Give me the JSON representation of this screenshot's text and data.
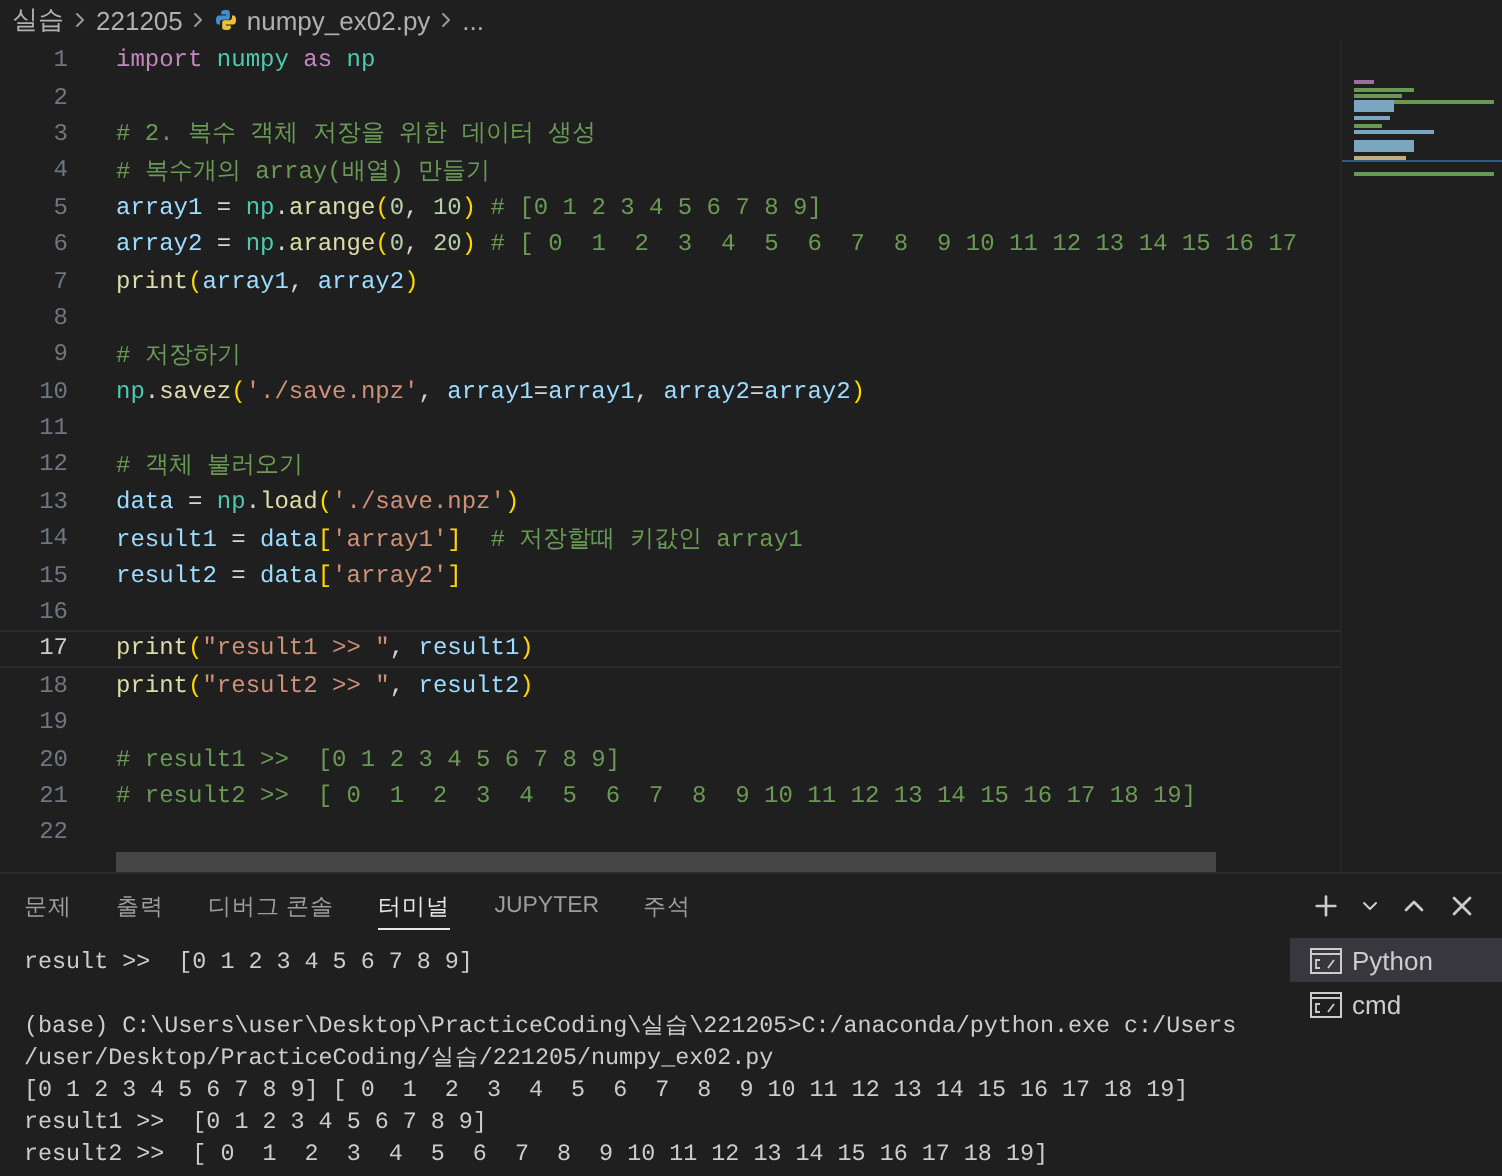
{
  "breadcrumb": [
    {
      "label": "실습",
      "kind": "folder"
    },
    {
      "label": "221205",
      "kind": "folder"
    },
    {
      "label": "numpy_ex02.py",
      "kind": "file"
    },
    {
      "label": "...",
      "kind": "more"
    }
  ],
  "editor": {
    "lines": [
      {
        "number": "1",
        "current": false,
        "tokens": [
          {
            "kind": "keyword",
            "text": "import "
          },
          {
            "kind": "module",
            "text": "numpy "
          },
          {
            "kind": "keyword",
            "text": "as "
          },
          {
            "kind": "module",
            "text": "np"
          }
        ]
      },
      {
        "number": "2",
        "current": false
      },
      {
        "number": "3",
        "current": false,
        "tokens": [
          {
            "kind": "comment",
            "text": "# 2. 복수 객체 저장을 위한 데이터 생성"
          }
        ]
      },
      {
        "number": "4",
        "current": false,
        "tokens": [
          {
            "kind": "comment",
            "text": "# 복수개의 array(배열) 만들기"
          }
        ]
      },
      {
        "number": "5",
        "current": false,
        "tokens": [
          {
            "kind": "variable",
            "text": "array1"
          },
          {
            "kind": "plain",
            "text": " = "
          },
          {
            "kind": "module",
            "text": "np"
          },
          {
            "kind": "plain",
            "text": "."
          },
          {
            "kind": "function",
            "text": "arange"
          },
          {
            "kind": "paren",
            "text": "("
          },
          {
            "kind": "number",
            "text": "0"
          },
          {
            "kind": "plain",
            "text": ", "
          },
          {
            "kind": "number",
            "text": "10"
          },
          {
            "kind": "paren",
            "text": ")"
          },
          {
            "kind": "comment",
            "text": " # [0 1 2 3 4 5 6 7 8 9]"
          }
        ]
      },
      {
        "number": "6",
        "current": false,
        "tokens": [
          {
            "kind": "variable",
            "text": "array2"
          },
          {
            "kind": "plain",
            "text": " = "
          },
          {
            "kind": "module",
            "text": "np"
          },
          {
            "kind": "plain",
            "text": "."
          },
          {
            "kind": "function",
            "text": "arange"
          },
          {
            "kind": "paren",
            "text": "("
          },
          {
            "kind": "number",
            "text": "0"
          },
          {
            "kind": "plain",
            "text": ", "
          },
          {
            "kind": "number",
            "text": "20"
          },
          {
            "kind": "paren",
            "text": ")"
          },
          {
            "kind": "comment",
            "text": " # [ 0  1  2  3  4  5  6  7  8  9 10 11 12 13 14 15 16 17"
          }
        ]
      },
      {
        "number": "7",
        "current": false,
        "tokens": [
          {
            "kind": "function",
            "text": "print"
          },
          {
            "kind": "paren",
            "text": "("
          },
          {
            "kind": "variable",
            "text": "array1"
          },
          {
            "kind": "plain",
            "text": ", "
          },
          {
            "kind": "variable",
            "text": "array2"
          },
          {
            "kind": "paren",
            "text": ")"
          }
        ]
      },
      {
        "number": "8",
        "current": false
      },
      {
        "number": "9",
        "current": false,
        "tokens": [
          {
            "kind": "comment",
            "text": "# 저장하기"
          }
        ]
      },
      {
        "number": "10",
        "current": false,
        "tokens": [
          {
            "kind": "module",
            "text": "np"
          },
          {
            "kind": "plain",
            "text": "."
          },
          {
            "kind": "function",
            "text": "savez"
          },
          {
            "kind": "paren",
            "text": "("
          },
          {
            "kind": "string",
            "text": "'./save.npz'"
          },
          {
            "kind": "plain",
            "text": ", "
          },
          {
            "kind": "variable",
            "text": "array1"
          },
          {
            "kind": "plain",
            "text": "="
          },
          {
            "kind": "variable",
            "text": "array1"
          },
          {
            "kind": "plain",
            "text": ", "
          },
          {
            "kind": "variable",
            "text": "array2"
          },
          {
            "kind": "plain",
            "text": "="
          },
          {
            "kind": "variable",
            "text": "array2"
          },
          {
            "kind": "paren",
            "text": ")"
          }
        ]
      },
      {
        "number": "11",
        "current": false
      },
      {
        "number": "12",
        "current": false,
        "tokens": [
          {
            "kind": "comment",
            "text": "# 객체 불러오기"
          }
        ]
      },
      {
        "number": "13",
        "current": false,
        "tokens": [
          {
            "kind": "variable",
            "text": "data"
          },
          {
            "kind": "plain",
            "text": " = "
          },
          {
            "kind": "module",
            "text": "np"
          },
          {
            "kind": "plain",
            "text": "."
          },
          {
            "kind": "function",
            "text": "load"
          },
          {
            "kind": "paren",
            "text": "("
          },
          {
            "kind": "string",
            "text": "'./save.npz'"
          },
          {
            "kind": "paren",
            "text": ")"
          }
        ]
      },
      {
        "number": "14",
        "current": false,
        "tokens": [
          {
            "kind": "variable",
            "text": "result1"
          },
          {
            "kind": "plain",
            "text": " = "
          },
          {
            "kind": "variable",
            "text": "data"
          },
          {
            "kind": "paren",
            "text": "["
          },
          {
            "kind": "string",
            "text": "'array1'"
          },
          {
            "kind": "paren",
            "text": "]"
          },
          {
            "kind": "comment",
            "text": "  # 저장할때 키값인 array1"
          }
        ]
      },
      {
        "number": "15",
        "current": false,
        "tokens": [
          {
            "kind": "variable",
            "text": "result2"
          },
          {
            "kind": "plain",
            "text": " = "
          },
          {
            "kind": "variable",
            "text": "data"
          },
          {
            "kind": "paren",
            "text": "["
          },
          {
            "kind": "string",
            "text": "'array2'"
          },
          {
            "kind": "paren",
            "text": "]"
          }
        ]
      },
      {
        "number": "16",
        "current": false
      },
      {
        "number": "17",
        "current": true,
        "tokens": [
          {
            "kind": "function",
            "text": "print"
          },
          {
            "kind": "paren",
            "text": "("
          },
          {
            "kind": "string",
            "text": "\"result1 >> \""
          },
          {
            "kind": "plain",
            "text": ", "
          },
          {
            "kind": "variable",
            "text": "result1"
          },
          {
            "kind": "paren",
            "text": ")"
          }
        ]
      },
      {
        "number": "18",
        "current": false,
        "tokens": [
          {
            "kind": "function",
            "text": "print"
          },
          {
            "kind": "paren",
            "text": "("
          },
          {
            "kind": "string",
            "text": "\"result2 >> \""
          },
          {
            "kind": "plain",
            "text": ", "
          },
          {
            "kind": "variable",
            "text": "result2"
          },
          {
            "kind": "paren",
            "text": ")"
          }
        ]
      },
      {
        "number": "19",
        "current": false
      },
      {
        "number": "20",
        "current": false,
        "tokens": [
          {
            "kind": "comment",
            "text": "# result1 >>  [0 1 2 3 4 5 6 7 8 9]"
          }
        ]
      },
      {
        "number": "21",
        "current": false,
        "tokens": [
          {
            "kind": "comment",
            "text": "# result2 >>  [ 0  1  2  3  4  5  6  7  8  9 10 11 12 13 14 15 16 17 18 19]"
          }
        ]
      },
      {
        "number": "22",
        "current": false
      }
    ]
  },
  "panel": {
    "tabs": [
      {
        "label": "문제",
        "selected": false
      },
      {
        "label": "출력",
        "selected": false
      },
      {
        "label": "디버그 콘솔",
        "selected": false
      },
      {
        "label": "터미널",
        "selected": true
      },
      {
        "label": "JUPYTER",
        "selected": false
      },
      {
        "label": "주석",
        "selected": false
      }
    ],
    "terminal_blocks": [
      [
        "result >>  [0 1 2 3 4 5 6 7 8 9]"
      ],
      [
        "(base) C:\\Users\\user\\Desktop\\PracticeCoding\\실습\\221205>C:/anaconda/python.exe c:/Users",
        "/user/Desktop/PracticeCoding/실습/221205/numpy_ex02.py",
        "[0 1 2 3 4 5 6 7 8 9] [ 0  1  2  3  4  5  6  7  8  9 10 11 12 13 14 15 16 17 18 19]",
        "result1 >>  [0 1 2 3 4 5 6 7 8 9]",
        "result2 >>  [ 0  1  2  3  4  5  6  7  8  9 10 11 12 13 14 15 16 17 18 19]"
      ]
    ],
    "terminals": [
      {
        "label": "Python",
        "selected": true
      },
      {
        "label": "cmd",
        "selected": false
      }
    ]
  }
}
